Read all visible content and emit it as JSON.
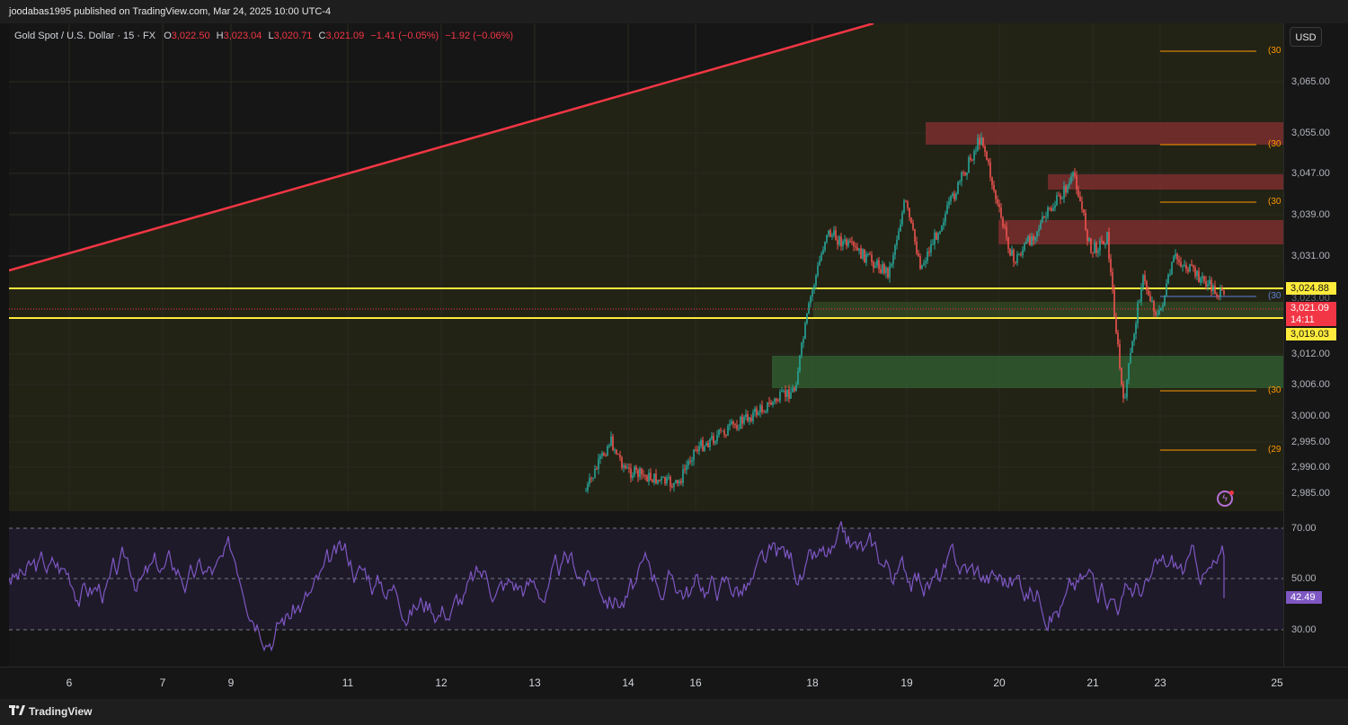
{
  "header": {
    "published": "joodabas1995 published on TradingView.com, Mar 24, 2025 10:00 UTC-4"
  },
  "legend": {
    "symbol": "Gold Spot / U.S. Dollar · 15 · FX",
    "o_label": "O",
    "o": "3,022.50",
    "h_label": "H",
    "h": "3,023.04",
    "l_label": "L",
    "l": "3,020.71",
    "c_label": "C",
    "c": "3,021.09",
    "change": "−1.41 (−0.05%)",
    "change2": "−1.92 (−0.06%)"
  },
  "currency_button": "USD",
  "price_axis": {
    "ticks": [
      "3,065.00",
      "3,055.00",
      "3,047.00",
      "3,039.00",
      "3,031.00",
      "3,012.00",
      "3,006.00",
      "3,000.00",
      "2,995.00",
      "2,990.00",
      "2,985.00"
    ],
    "level_upper": "3,024.88",
    "current_price": "3,021.09",
    "countdown": "14:11",
    "level_lower": "3,019.03",
    "hidden_tick": "3,023.00"
  },
  "fib_labels": [
    "(30",
    "(30",
    "(30",
    "(30",
    "(30",
    "(29"
  ],
  "rsi": {
    "ticks": [
      "70.00",
      "50.00",
      "30.00"
    ],
    "value": "42.49",
    "value_num": 42.49,
    "line_color": "#7e57c2"
  },
  "time_axis": {
    "labels": [
      "6",
      "7",
      "9",
      "11",
      "12",
      "13",
      "14",
      "16",
      "18",
      "19",
      "20",
      "21",
      "23",
      "25"
    ]
  },
  "chart_data": {
    "type": "candlestick",
    "symbol": "Gold Spot / U.S. Dollar",
    "interval": "15",
    "ylim": [
      2979,
      3075
    ],
    "last_close": 3021.09,
    "levels": [
      3024.88,
      3019.03
    ],
    "x_labels": [
      "6",
      "7",
      "9",
      "11",
      "12",
      "13",
      "14",
      "16",
      "18",
      "19",
      "20",
      "21",
      "23",
      "25"
    ],
    "price_path": [
      {
        "x": "13",
        "y": 2983
      },
      {
        "x": "14",
        "y": 2993
      },
      {
        "x": "14",
        "y": 2987
      },
      {
        "x": "16",
        "y": 2984
      },
      {
        "x": "16",
        "y": 2991
      },
      {
        "x": "18",
        "y": 3003
      },
      {
        "x": "18",
        "y": 3021
      },
      {
        "x": "18",
        "y": 3034
      },
      {
        "x": "19",
        "y": 3026
      },
      {
        "x": "19",
        "y": 3040
      },
      {
        "x": "19",
        "y": 3027
      },
      {
        "x": "20",
        "y": 3053
      },
      {
        "x": "20",
        "y": 3039
      },
      {
        "x": "20",
        "y": 3028
      },
      {
        "x": "21",
        "y": 3045
      },
      {
        "x": "21",
        "y": 3030
      },
      {
        "x": "21",
        "y": 3033
      },
      {
        "x": "21",
        "y": 3000
      },
      {
        "x": "23",
        "y": 3025
      },
      {
        "x": "23",
        "y": 3017
      },
      {
        "x": "23",
        "y": 3029
      },
      {
        "x": "23",
        "y": 3021
      }
    ],
    "rsi_levels": [
      70,
      50,
      30
    ],
    "rsi_last": 42.49,
    "colors": {
      "up": "#26a69a",
      "down": "#ef5350",
      "trendline": "#f23645",
      "level": "#ffeb3b",
      "fib": "#ff9800"
    }
  },
  "footer": {
    "brand": "TradingView"
  }
}
